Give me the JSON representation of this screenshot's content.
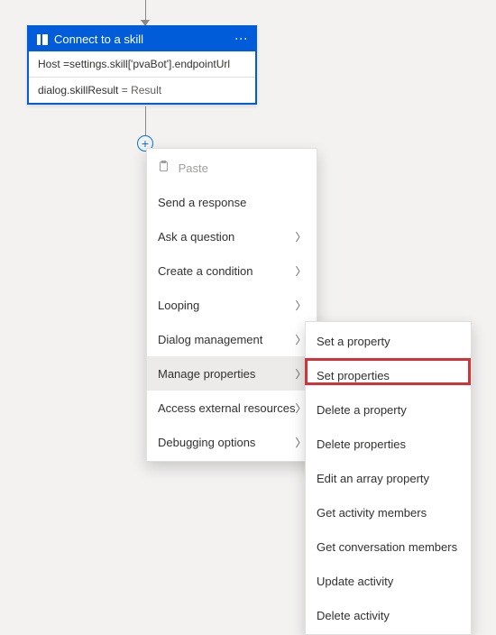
{
  "node": {
    "title": "Connect to a skill",
    "row1_prefix": "Host ",
    "row1_value": "=settings.skill['pvaBot'].endpointUrl",
    "row2_field": "dialog.skillResult",
    "row2_eq": " = ",
    "row2_value": "Result"
  },
  "primaryMenu": {
    "paste": "Paste",
    "items": [
      {
        "label": "Send a response",
        "hasSub": false
      },
      {
        "label": "Ask a question",
        "hasSub": true
      },
      {
        "label": "Create a condition",
        "hasSub": true
      },
      {
        "label": "Looping",
        "hasSub": true
      },
      {
        "label": "Dialog management",
        "hasSub": true
      },
      {
        "label": "Manage properties",
        "hasSub": true
      },
      {
        "label": "Access external resources",
        "hasSub": true
      },
      {
        "label": "Debugging options",
        "hasSub": true
      }
    ]
  },
  "subMenu": {
    "items": [
      "Set a property",
      "Set properties",
      "Delete a property",
      "Delete properties",
      "Edit an array property",
      "Get activity members",
      "Get conversation members",
      "Update activity",
      "Delete activity"
    ]
  }
}
